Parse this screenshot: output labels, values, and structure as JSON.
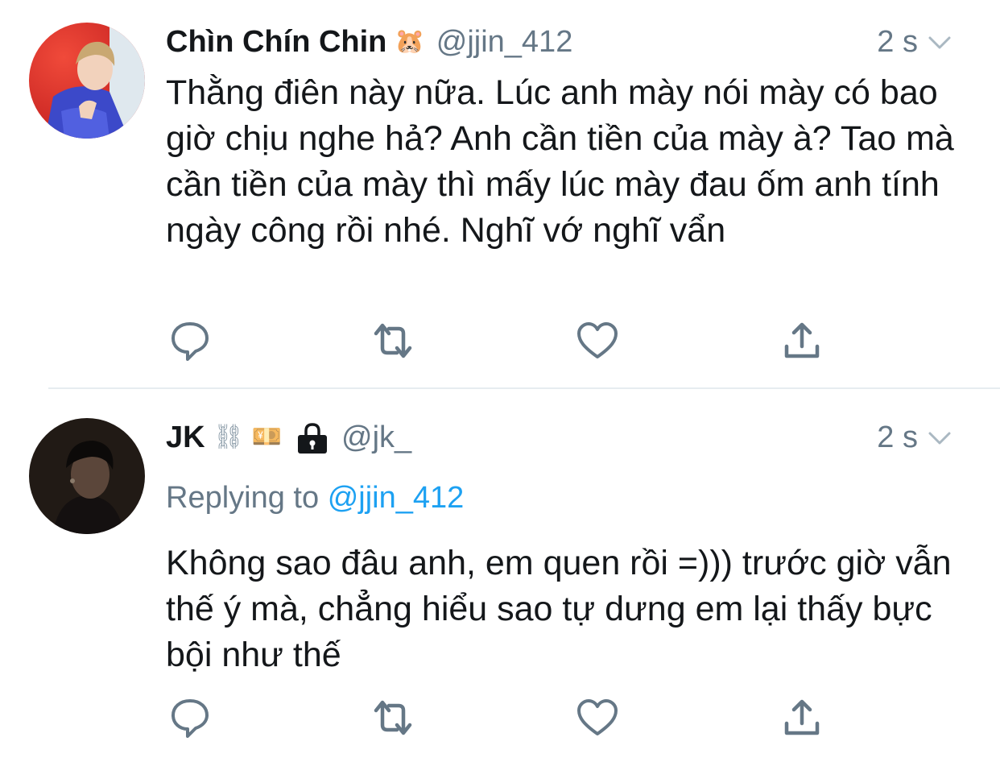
{
  "tweets": [
    {
      "display_name": "Chìn Chín Chin",
      "badges": [
        "🐹"
      ],
      "handle": "@jjin_412",
      "time": "2 s",
      "text": "Thằng điên này nữa. Lúc anh mày nói mày có bao giờ chịu nghe hả? Anh cần tiền của mày à? Tao mà cần tiền của mày thì mấy lúc mày đau ốm anh tính ngày công rồi nhé. Nghĩ vớ nghĩ vẩn",
      "icons": [
        "avatar-photo",
        "chevron-down-icon",
        "reply-icon",
        "retweet-icon",
        "like-icon",
        "share-icon"
      ]
    },
    {
      "display_name": "JK",
      "badges": [
        "⛓",
        "💴"
      ],
      "handle": "@jk_",
      "time": "2 s",
      "replying_prefix": "Replying to",
      "replying_to": "@jjin_412",
      "text": "Không sao đâu anh, em quen rồi =))) trước giờ vẫn thế ý mà, chẳng hiểu sao tự dưng em lại thấy bực bội như thế",
      "icons": [
        "avatar-photo",
        "lock-icon",
        "chevron-down-icon",
        "reply-icon",
        "retweet-icon",
        "like-icon",
        "share-icon"
      ]
    }
  ],
  "colors": {
    "text": "#14171a",
    "secondary": "#657786",
    "link": "#1da1f2",
    "divider": "#e6ecf0",
    "icon": "#657786"
  }
}
